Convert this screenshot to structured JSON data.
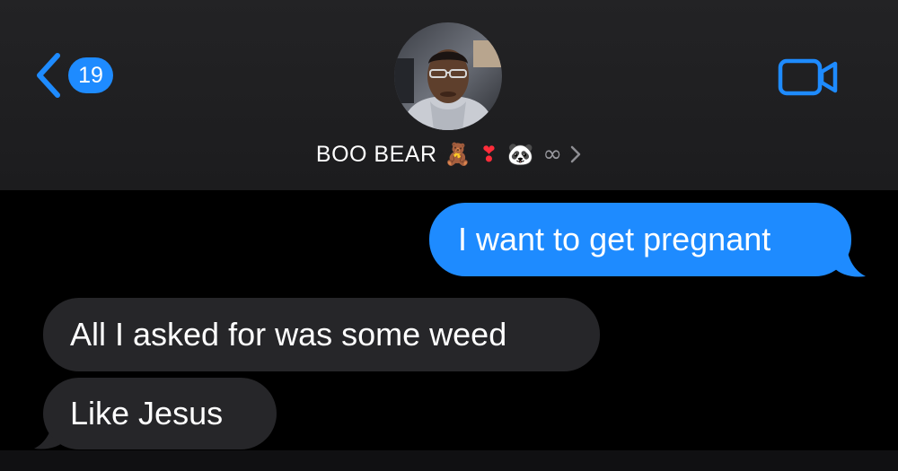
{
  "header": {
    "back_badge_count": "19",
    "contact_name": "BOO BEAR",
    "name_emojis": {
      "bear": "🧸",
      "heart": "❣",
      "panda": "🐼",
      "infinity": "∞"
    },
    "icons": {
      "back": "chevron-left-icon",
      "video": "video-camera-icon",
      "details": "chevron-right-icon"
    }
  },
  "messages": [
    {
      "direction": "sent",
      "text": "I want to get pregnant"
    },
    {
      "direction": "received",
      "text": "All I asked for was some weed"
    },
    {
      "direction": "received",
      "text": "Like Jesus"
    }
  ],
  "colors": {
    "accent_blue": "#1e8bff",
    "received_bubble": "#262629",
    "header_bg": "#1c1c1e",
    "background": "#000000"
  }
}
